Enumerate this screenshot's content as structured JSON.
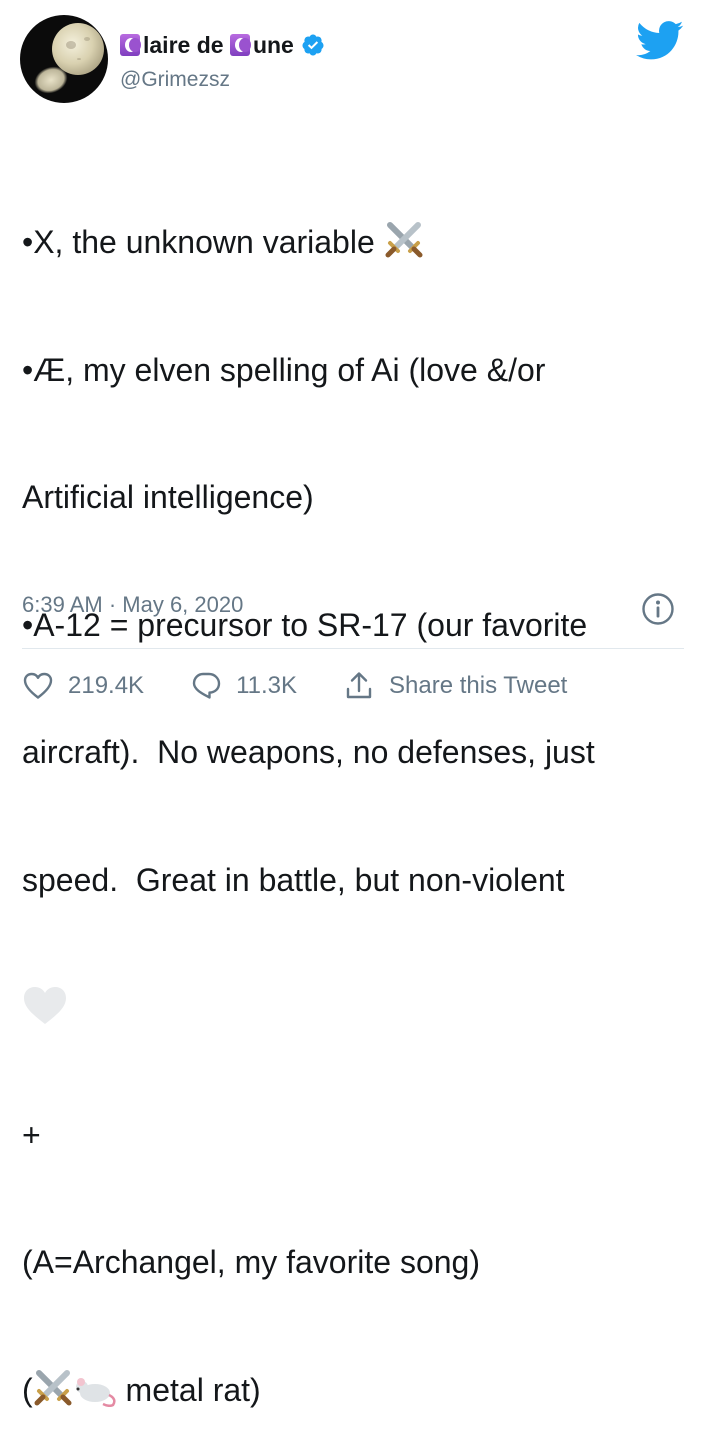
{
  "author": {
    "display_name_part1": "laire de ",
    "display_name_part2": "une",
    "moon_glyph_icon": "crescent-moon-box-icon",
    "handle": "@Grimezsz",
    "verified_icon": "verified-badge-icon"
  },
  "tweet": {
    "lines": [
      "•X, the unknown variable ",
      "•Æ, my elven spelling of Ai (love &/or",
      "Artificial intelligence)",
      "•A-12 = precursor to SR-17 (our favorite",
      "aircraft).  No weapons, no defenses, just",
      "speed.  Great in battle, but non-violent",
      "",
      "+",
      "(A=Archangel, my favorite song)",
      "(",
      " metal rat)"
    ]
  },
  "meta": {
    "timestamp": "6:39 AM · May 6, 2020"
  },
  "actions": {
    "likes": "219.4K",
    "replies": "11.3K",
    "share": "Share this Tweet"
  },
  "colors": {
    "text": "#14171a",
    "secondary": "#657786",
    "twitter_blue": "#1da1f2",
    "divider": "#e1e8ed"
  }
}
